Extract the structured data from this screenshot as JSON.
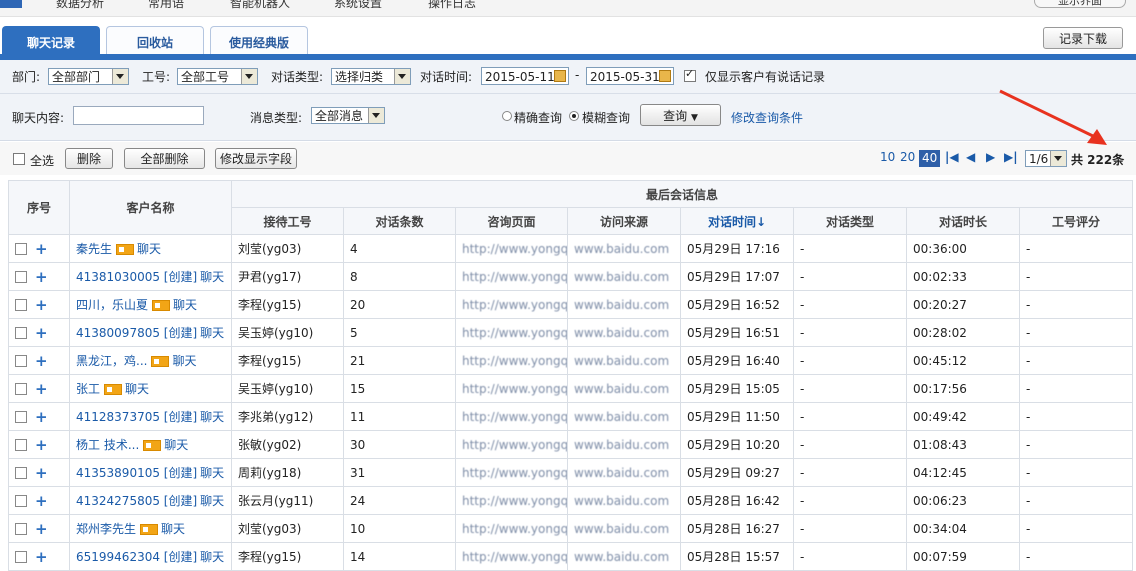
{
  "nav": {
    "items": [
      "数据分析",
      "常用语",
      "智能机器人",
      "系统设置",
      "操作日志"
    ],
    "right_control": "显示界面"
  },
  "tabs": [
    {
      "label": "聊天记录",
      "active": true
    },
    {
      "label": "回收站",
      "active": false
    },
    {
      "label": "使用经典版",
      "active": false
    }
  ],
  "download_button": "记录下载",
  "filter": {
    "dept_label": "部门:",
    "dept_value": "全部部门",
    "staff_label": "工号:",
    "staff_value": "全部工号",
    "type_label": "对话类型:",
    "type_value": "选择归类",
    "time_label": "对话时间:",
    "date_from": "2015-05-11",
    "date_sep": "-",
    "date_to": "2015-05-31",
    "only_customer_label": "仅显示客户有说话记录",
    "only_customer_checked": true,
    "content_label": "聊天内容:",
    "content_value": "",
    "msgtype_label": "消息类型:",
    "msgtype_value": "全部消息",
    "exact_label": "精确查询",
    "fuzzy_label": "模糊查询",
    "search_mode": "fuzzy",
    "query_button": "查询",
    "modify_link": "修改查询条件"
  },
  "toolbar": {
    "select_all": "全选",
    "delete": "删除",
    "delete_all": "全部删除",
    "modify_fields": "修改显示字段",
    "page_sizes": [
      "10",
      "20",
      "40"
    ],
    "current_page_size": "40",
    "page_select": "1/6",
    "total": "共 222条"
  },
  "table": {
    "header_seq": "序号",
    "header_name": "客户名称",
    "header_group": "最后会话信息",
    "columns": [
      "接待工号",
      "对话条数",
      "咨询页面",
      "访问来源",
      "对话时间↓",
      "对话类型",
      "对话时长",
      "工号评分"
    ],
    "rows": [
      {
        "name": "秦先生",
        "card": true,
        "chat": "聊天",
        "staff": "刘莹(yg03)",
        "count": "4",
        "page": "http://www.yongqua",
        "source": "www.baidu.com",
        "time": "05月29日  17:16",
        "type": "-",
        "duration": "00:36:00",
        "score": "-"
      },
      {
        "name": "41381030005 [创建]",
        "card": false,
        "chat": "聊天",
        "staff": "尹君(yg17)",
        "count": "8",
        "page": "http://www.yongqua",
        "source": "www.baidu.com",
        "time": "05月29日  17:07",
        "type": "-",
        "duration": "00:02:33",
        "score": "-"
      },
      {
        "name": "四川，乐山夏",
        "card": true,
        "chat": "聊天",
        "staff": "李程(yg15)",
        "count": "20",
        "page": "http://www.yongqua",
        "source": "www.baidu.com",
        "time": "05月29日  16:52",
        "type": "-",
        "duration": "00:20:27",
        "score": "-"
      },
      {
        "name": "41380097805 [创建]",
        "card": false,
        "chat": "聊天",
        "staff": "吴玉婷(yg10)",
        "count": "5",
        "page": "http://www.yongqua",
        "source": "www.baidu.com",
        "time": "05月29日  16:51",
        "type": "-",
        "duration": "00:28:02",
        "score": "-"
      },
      {
        "name": "黑龙江，鸡...",
        "card": true,
        "chat": "聊天",
        "staff": "李程(yg15)",
        "count": "21",
        "page": "http://www.yongqua",
        "source": "www.baidu.com",
        "time": "05月29日  16:40",
        "type": "-",
        "duration": "00:45:12",
        "score": "-"
      },
      {
        "name": "张工",
        "card": true,
        "chat": "聊天",
        "staff": "吴玉婷(yg10)",
        "count": "15",
        "page": "http://www.yongqua",
        "source": "www.baidu.com",
        "time": "05月29日  15:05",
        "type": "-",
        "duration": "00:17:56",
        "score": "-"
      },
      {
        "name": "41128373705 [创建]",
        "card": false,
        "chat": "聊天",
        "staff": "李兆弟(yg12)",
        "count": "11",
        "page": "http://www.yongqua",
        "source": "www.baidu.com",
        "time": "05月29日  11:50",
        "type": "-",
        "duration": "00:49:42",
        "score": "-"
      },
      {
        "name": "杨工 技术...",
        "card": true,
        "chat": "聊天",
        "staff": "张敏(yg02)",
        "count": "30",
        "page": "http://www.yongqua",
        "source": "www.baidu.com",
        "time": "05月29日  10:20",
        "type": "-",
        "duration": "01:08:43",
        "score": "-"
      },
      {
        "name": "41353890105 [创建]",
        "card": false,
        "chat": "聊天",
        "staff": "周莉(yg18)",
        "count": "31",
        "page": "http://www.yongqua",
        "source": "www.baidu.com",
        "time": "05月29日  09:27",
        "type": "-",
        "duration": "04:12:45",
        "score": "-"
      },
      {
        "name": "41324275805 [创建]",
        "card": false,
        "chat": "聊天",
        "staff": "张云月(yg11)",
        "count": "24",
        "page": "http://www.yongqua",
        "source": "www.baidu.com",
        "time": "05月28日  16:42",
        "type": "-",
        "duration": "00:06:23",
        "score": "-"
      },
      {
        "name": "郑州李先生",
        "card": true,
        "chat": "聊天",
        "staff": "刘莹(yg03)",
        "count": "10",
        "page": "http://www.yongqua",
        "source": "www.baidu.com",
        "time": "05月28日  16:27",
        "type": "-",
        "duration": "00:34:04",
        "score": "-"
      },
      {
        "name": "65199462304 [创建]",
        "card": false,
        "chat": "聊天",
        "staff": "李程(yg15)",
        "count": "14",
        "page": "http://www.yongqua",
        "source": "www.baidu.com",
        "time": "05月28日  15:57",
        "type": "-",
        "duration": "00:07:59",
        "score": "-"
      }
    ]
  },
  "colors": {
    "accent": "#2e6fbf",
    "link": "#1a5aa8",
    "annotation_arrow": "#e8321f"
  }
}
